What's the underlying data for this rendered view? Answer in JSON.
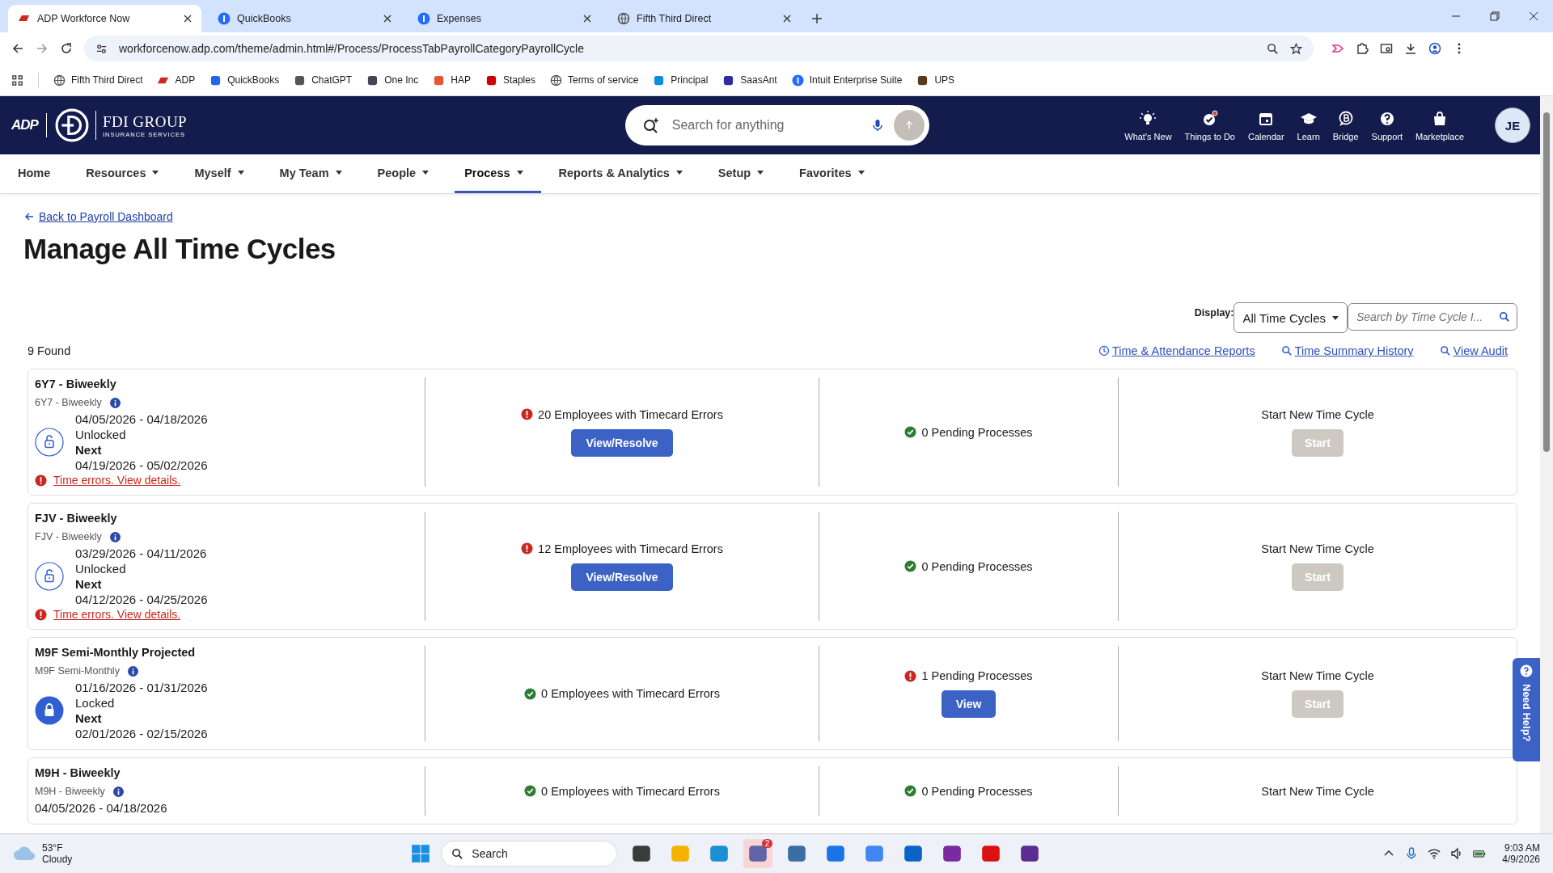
{
  "browser": {
    "tabs": [
      {
        "title": "ADP Workforce Now",
        "kind": "adp",
        "selected": true
      },
      {
        "title": "QuickBooks",
        "kind": "intuit",
        "selected": false
      },
      {
        "title": "Expenses",
        "kind": "intuit",
        "selected": false
      },
      {
        "title": "Fifth Third Direct",
        "kind": "globe",
        "selected": false
      }
    ],
    "address": "workforcenow.adp.com/theme/admin.html#/Process/ProcessTabPayrollCategoryPayrollCycle",
    "bookmarks": [
      {
        "label": "Fifth Third Direct",
        "kind": "globe"
      },
      {
        "label": "ADP",
        "kind": "adp"
      },
      {
        "label": "QuickBooks",
        "kind": "square"
      },
      {
        "label": "ChatGPT",
        "kind": "knot"
      },
      {
        "label": "One Inc",
        "kind": "wave"
      },
      {
        "label": "HAP",
        "kind": "pill"
      },
      {
        "label": "Staples",
        "kind": "staple"
      },
      {
        "label": "Terms of service",
        "kind": "globe"
      },
      {
        "label": "Principal",
        "kind": "drop"
      },
      {
        "label": "SaasAnt",
        "kind": "dash"
      },
      {
        "label": "Intuit Enterprise Suite",
        "kind": "intuit"
      },
      {
        "label": "UPS",
        "kind": "shield"
      }
    ]
  },
  "header": {
    "brand": "ADP",
    "company": "FDI GROUP",
    "company_sub": "INSURANCE SERVICES",
    "search_placeholder": "Search for anything",
    "items": [
      {
        "label": "What's New",
        "kind": "bulb",
        "alert": false
      },
      {
        "label": "Things to Do",
        "kind": "check",
        "alert": true
      },
      {
        "label": "Calendar",
        "kind": "calendar",
        "alert": false
      },
      {
        "label": "Learn",
        "kind": "cap",
        "alert": false
      },
      {
        "label": "Bridge",
        "kind": "bridge",
        "alert": false
      },
      {
        "label": "Support",
        "kind": "help",
        "alert": false
      },
      {
        "label": "Marketplace",
        "kind": "bag",
        "alert": false
      }
    ],
    "avatar": "JE"
  },
  "nav": [
    {
      "label": "Home",
      "menu": false,
      "selected": false
    },
    {
      "label": "Resources",
      "menu": true,
      "selected": false
    },
    {
      "label": "Myself",
      "menu": true,
      "selected": false
    },
    {
      "label": "My Team",
      "menu": true,
      "selected": false
    },
    {
      "label": "People",
      "menu": true,
      "selected": false
    },
    {
      "label": "Process",
      "menu": true,
      "selected": true
    },
    {
      "label": "Reports & Analytics",
      "menu": true,
      "selected": false
    },
    {
      "label": "Setup",
      "menu": true,
      "selected": false
    },
    {
      "label": "Favorites",
      "menu": true,
      "selected": false
    }
  ],
  "page": {
    "back_link": "Back to Payroll Dashboard",
    "title": "Manage All Time Cycles",
    "display_label": "Display:",
    "display_value": "All Time Cycles",
    "search_placeholder": "Search by Time Cycle I...",
    "found": "9 Found",
    "links": [
      {
        "label": "Time & Attendance Reports",
        "kind": "clock"
      },
      {
        "label": "Time Summary History",
        "kind": "search"
      },
      {
        "label": "View Audit",
        "kind": "search"
      }
    ],
    "cycles": [
      {
        "title": "6Y7 - Biweekly",
        "subtitle": "6Y7 - Biweekly",
        "range": "04/05/2026 - 04/18/2026",
        "lock_status": "Unlocked",
        "locked": false,
        "next_label": "Next",
        "next_range": "04/19/2026 - 05/02/2026",
        "error": "Time errors. View details.",
        "timecard": {
          "alert": true,
          "text": "20 Employees with Timecard Errors",
          "button": "View/Resolve"
        },
        "pending": {
          "alert": false,
          "text": "0 Pending Processes"
        },
        "start": {
          "label": "Start New Time Cycle",
          "button": "Start",
          "disabled": true
        }
      },
      {
        "title": "FJV - Biweekly",
        "subtitle": "FJV - Biweekly",
        "range": "03/29/2026 - 04/11/2026",
        "lock_status": "Unlocked",
        "locked": false,
        "next_label": "Next",
        "next_range": "04/12/2026 - 04/25/2026",
        "error": "Time errors. View details.",
        "timecard": {
          "alert": true,
          "text": "12 Employees with Timecard Errors",
          "button": "View/Resolve"
        },
        "pending": {
          "alert": false,
          "text": "0 Pending Processes"
        },
        "start": {
          "label": "Start New Time Cycle",
          "button": "Start",
          "disabled": true
        }
      },
      {
        "title": "M9F Semi-Monthly Projected",
        "subtitle": "M9F Semi-Monthly",
        "range": "01/16/2026 - 01/31/2026",
        "lock_status": "Locked",
        "locked": true,
        "next_label": "Next",
        "next_range": "02/01/2026 - 02/15/2026",
        "timecard": {
          "alert": false,
          "text": "0 Employees with Timecard Errors"
        },
        "pending": {
          "alert": true,
          "text": "1 Pending Processes",
          "button": "View"
        },
        "start": {
          "label": "Start New Time Cycle",
          "button": "Start",
          "disabled": true
        }
      },
      {
        "title": "M9H - Biweekly",
        "subtitle": "M9H - Biweekly",
        "range": "04/05/2026 - 04/18/2026",
        "timecard": {
          "alert": false,
          "text": "0 Employees with Timecard Errors"
        },
        "pending": {
          "alert": false,
          "text": "0 Pending Processes"
        },
        "start": {
          "label": "Start New Time Cycle"
        }
      }
    ],
    "help_tab": "Need Help?"
  },
  "taskbar": {
    "temperature": "53°F",
    "condition": "Cloudy",
    "search_placeholder": "Search",
    "teams_badge": "2",
    "time": "9:03 AM",
    "date": "4/9/2026"
  }
}
